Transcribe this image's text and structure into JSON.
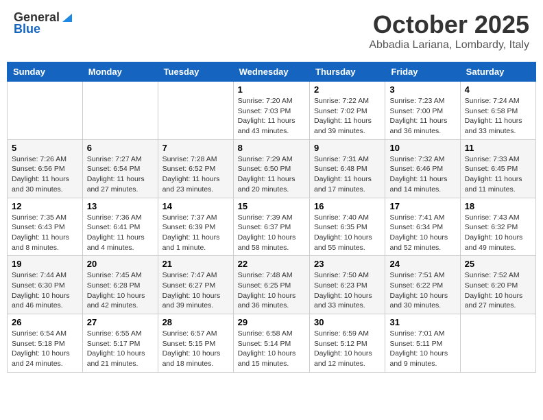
{
  "header": {
    "logo_general": "General",
    "logo_blue": "Blue",
    "month": "October 2025",
    "location": "Abbadia Lariana, Lombardy, Italy"
  },
  "weekdays": [
    "Sunday",
    "Monday",
    "Tuesday",
    "Wednesday",
    "Thursday",
    "Friday",
    "Saturday"
  ],
  "weeks": [
    [
      {
        "day": "",
        "info": ""
      },
      {
        "day": "",
        "info": ""
      },
      {
        "day": "",
        "info": ""
      },
      {
        "day": "1",
        "info": "Sunrise: 7:20 AM\nSunset: 7:03 PM\nDaylight: 11 hours\nand 43 minutes."
      },
      {
        "day": "2",
        "info": "Sunrise: 7:22 AM\nSunset: 7:02 PM\nDaylight: 11 hours\nand 39 minutes."
      },
      {
        "day": "3",
        "info": "Sunrise: 7:23 AM\nSunset: 7:00 PM\nDaylight: 11 hours\nand 36 minutes."
      },
      {
        "day": "4",
        "info": "Sunrise: 7:24 AM\nSunset: 6:58 PM\nDaylight: 11 hours\nand 33 minutes."
      }
    ],
    [
      {
        "day": "5",
        "info": "Sunrise: 7:26 AM\nSunset: 6:56 PM\nDaylight: 11 hours\nand 30 minutes."
      },
      {
        "day": "6",
        "info": "Sunrise: 7:27 AM\nSunset: 6:54 PM\nDaylight: 11 hours\nand 27 minutes."
      },
      {
        "day": "7",
        "info": "Sunrise: 7:28 AM\nSunset: 6:52 PM\nDaylight: 11 hours\nand 23 minutes."
      },
      {
        "day": "8",
        "info": "Sunrise: 7:29 AM\nSunset: 6:50 PM\nDaylight: 11 hours\nand 20 minutes."
      },
      {
        "day": "9",
        "info": "Sunrise: 7:31 AM\nSunset: 6:48 PM\nDaylight: 11 hours\nand 17 minutes."
      },
      {
        "day": "10",
        "info": "Sunrise: 7:32 AM\nSunset: 6:46 PM\nDaylight: 11 hours\nand 14 minutes."
      },
      {
        "day": "11",
        "info": "Sunrise: 7:33 AM\nSunset: 6:45 PM\nDaylight: 11 hours\nand 11 minutes."
      }
    ],
    [
      {
        "day": "12",
        "info": "Sunrise: 7:35 AM\nSunset: 6:43 PM\nDaylight: 11 hours\nand 8 minutes."
      },
      {
        "day": "13",
        "info": "Sunrise: 7:36 AM\nSunset: 6:41 PM\nDaylight: 11 hours\nand 4 minutes."
      },
      {
        "day": "14",
        "info": "Sunrise: 7:37 AM\nSunset: 6:39 PM\nDaylight: 11 hours\nand 1 minute."
      },
      {
        "day": "15",
        "info": "Sunrise: 7:39 AM\nSunset: 6:37 PM\nDaylight: 10 hours\nand 58 minutes."
      },
      {
        "day": "16",
        "info": "Sunrise: 7:40 AM\nSunset: 6:35 PM\nDaylight: 10 hours\nand 55 minutes."
      },
      {
        "day": "17",
        "info": "Sunrise: 7:41 AM\nSunset: 6:34 PM\nDaylight: 10 hours\nand 52 minutes."
      },
      {
        "day": "18",
        "info": "Sunrise: 7:43 AM\nSunset: 6:32 PM\nDaylight: 10 hours\nand 49 minutes."
      }
    ],
    [
      {
        "day": "19",
        "info": "Sunrise: 7:44 AM\nSunset: 6:30 PM\nDaylight: 10 hours\nand 46 minutes."
      },
      {
        "day": "20",
        "info": "Sunrise: 7:45 AM\nSunset: 6:28 PM\nDaylight: 10 hours\nand 42 minutes."
      },
      {
        "day": "21",
        "info": "Sunrise: 7:47 AM\nSunset: 6:27 PM\nDaylight: 10 hours\nand 39 minutes."
      },
      {
        "day": "22",
        "info": "Sunrise: 7:48 AM\nSunset: 6:25 PM\nDaylight: 10 hours\nand 36 minutes."
      },
      {
        "day": "23",
        "info": "Sunrise: 7:50 AM\nSunset: 6:23 PM\nDaylight: 10 hours\nand 33 minutes."
      },
      {
        "day": "24",
        "info": "Sunrise: 7:51 AM\nSunset: 6:22 PM\nDaylight: 10 hours\nand 30 minutes."
      },
      {
        "day": "25",
        "info": "Sunrise: 7:52 AM\nSunset: 6:20 PM\nDaylight: 10 hours\nand 27 minutes."
      }
    ],
    [
      {
        "day": "26",
        "info": "Sunrise: 6:54 AM\nSunset: 5:18 PM\nDaylight: 10 hours\nand 24 minutes."
      },
      {
        "day": "27",
        "info": "Sunrise: 6:55 AM\nSunset: 5:17 PM\nDaylight: 10 hours\nand 21 minutes."
      },
      {
        "day": "28",
        "info": "Sunrise: 6:57 AM\nSunset: 5:15 PM\nDaylight: 10 hours\nand 18 minutes."
      },
      {
        "day": "29",
        "info": "Sunrise: 6:58 AM\nSunset: 5:14 PM\nDaylight: 10 hours\nand 15 minutes."
      },
      {
        "day": "30",
        "info": "Sunrise: 6:59 AM\nSunset: 5:12 PM\nDaylight: 10 hours\nand 12 minutes."
      },
      {
        "day": "31",
        "info": "Sunrise: 7:01 AM\nSunset: 5:11 PM\nDaylight: 10 hours\nand 9 minutes."
      },
      {
        "day": "",
        "info": ""
      }
    ]
  ]
}
